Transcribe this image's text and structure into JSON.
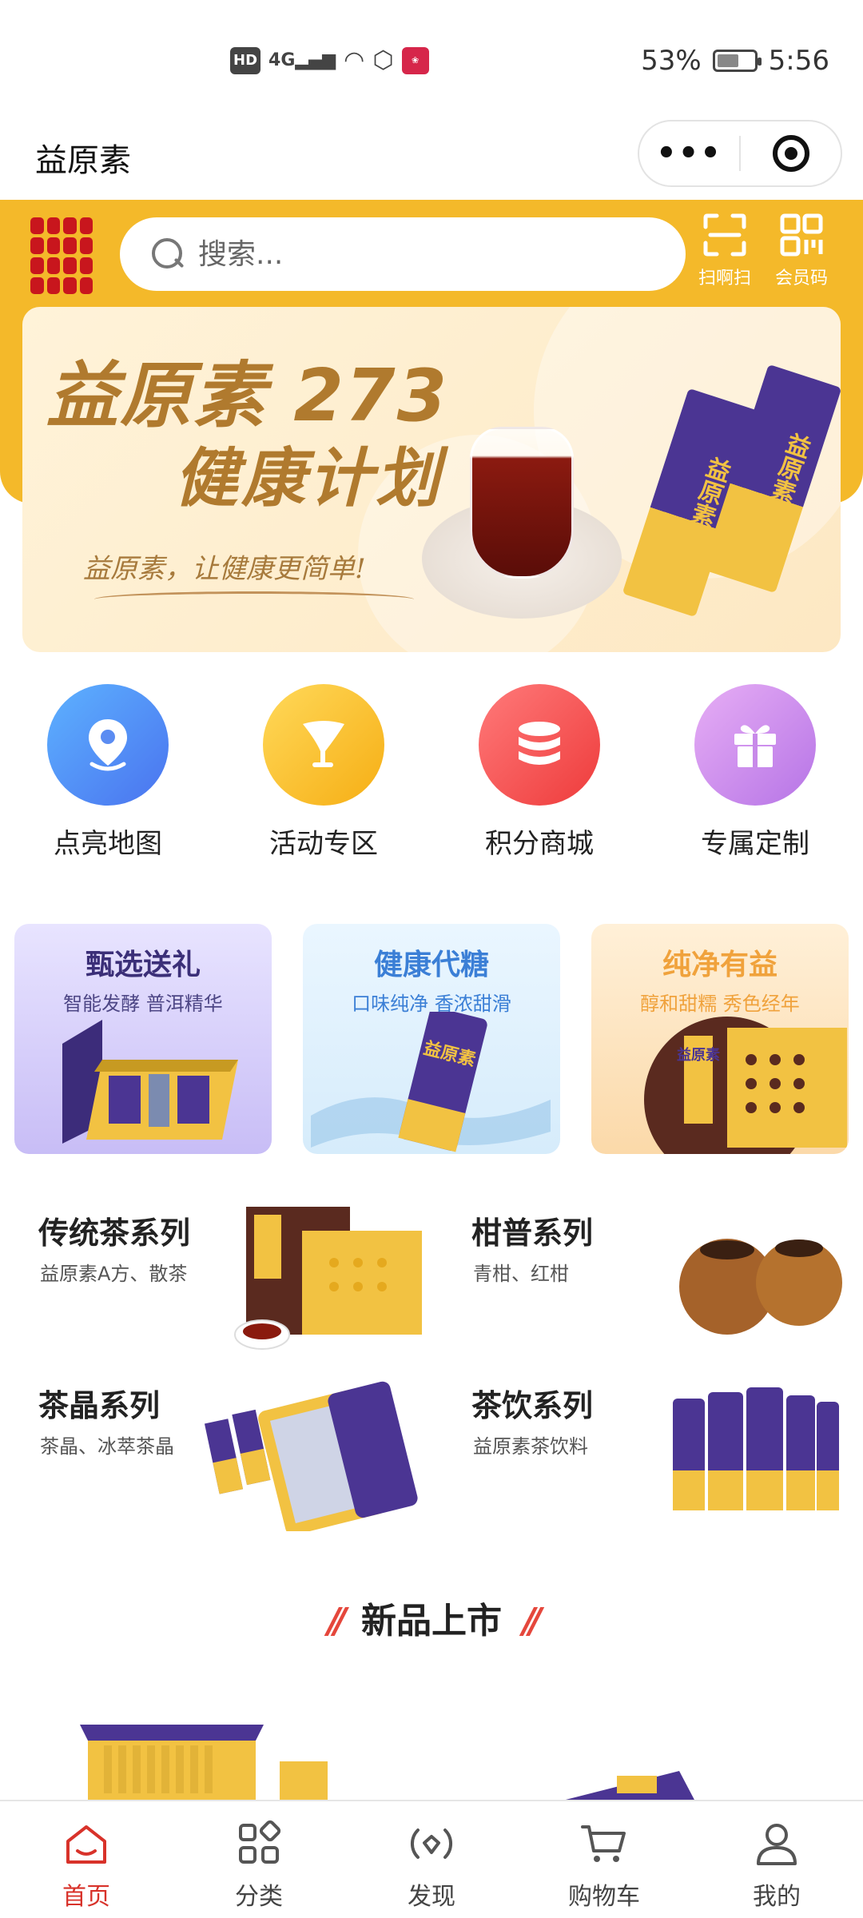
{
  "status_bar": {
    "hd": "HD",
    "network": "4G",
    "battery": "53%",
    "time": "5:56",
    "battery_level": 0.53
  },
  "title_bar": {
    "title": "益原素",
    "more_label": "•••"
  },
  "header": {
    "search_placeholder": "搜索...",
    "scan_label": "扫啊扫",
    "member_code_label": "会员码"
  },
  "banner": {
    "title_line1": "益原素 273",
    "title_line2": "健康计划",
    "slogan": "益原素，让健康更简单!",
    "sachet_label": "益原素"
  },
  "quick_nav": [
    {
      "label": "点亮地图",
      "icon": "map-pin-icon"
    },
    {
      "label": "活动专区",
      "icon": "flag-icon"
    },
    {
      "label": "积分商城",
      "icon": "coins-icon"
    },
    {
      "label": "专属定制",
      "icon": "gift-icon"
    }
  ],
  "promos": [
    {
      "title": "甄选送礼",
      "subtitle": "智能发酵 普洱精华"
    },
    {
      "title": "健康代糖",
      "subtitle": "口味纯净 香浓甜滑",
      "product_label": "益原素"
    },
    {
      "title": "纯净有益",
      "subtitle": "醇和甜糯 秀色经年",
      "product_label": "益原素"
    }
  ],
  "series": [
    {
      "title": "传统茶系列",
      "subtitle": "益原素A方、散茶"
    },
    {
      "title": "柑普系列",
      "subtitle": "青柑、红柑"
    },
    {
      "title": "茶晶系列",
      "subtitle": "茶晶、冰萃茶晶"
    },
    {
      "title": "茶饮系列",
      "subtitle": "益原素茶饮料"
    }
  ],
  "new_arrivals": {
    "title": "新品上市",
    "slash": "//"
  },
  "tab_bar": [
    {
      "label": "首页",
      "icon": "home-icon",
      "active": true
    },
    {
      "label": "分类",
      "icon": "category-icon",
      "active": false
    },
    {
      "label": "发现",
      "icon": "discover-icon",
      "active": false
    },
    {
      "label": "购物车",
      "icon": "cart-icon",
      "active": false
    },
    {
      "label": "我的",
      "icon": "user-icon",
      "active": false
    }
  ],
  "colors": {
    "brand_yellow": "#f4b92a",
    "brand_red": "#c8161d",
    "brand_purple": "#4b3593",
    "active_tab": "#d8322a"
  }
}
